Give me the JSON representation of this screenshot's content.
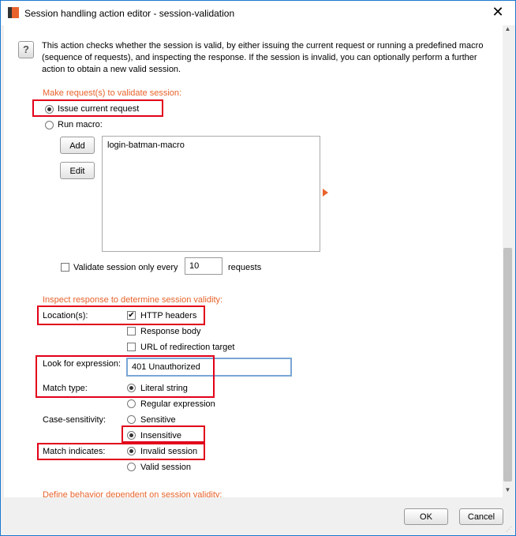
{
  "window": {
    "title": "Session handling action editor - session-validation"
  },
  "help": {
    "text": "This action checks whether the session is valid, by either issuing the current request or running a predefined macro (sequence of requests), and inspecting the response. If the session is invalid, you can optionally perform a further action to obtain a new valid session."
  },
  "request_section": {
    "heading": "Make request(s) to validate session:",
    "issue_current": "Issue current request",
    "run_macro": "Run macro:",
    "add_button": "Add",
    "edit_button": "Edit",
    "macros": [
      "login-batman-macro"
    ],
    "validate_label": "Validate session only every",
    "validate_value": "10",
    "validate_suffix": "requests"
  },
  "inspect_section": {
    "heading": "Inspect response to determine session validity:",
    "location_label": "Location(s):",
    "loc_headers": "HTTP headers",
    "loc_body": "Response body",
    "loc_redirect": "URL of redirection target",
    "expression_label": "Look for expression:",
    "expression_value": "401 Unauthorized",
    "match_type_label": "Match type:",
    "literal": "Literal string",
    "regex": "Regular expression",
    "case_label": "Case-sensitivity:",
    "sensitive": "Sensitive",
    "insensitive": "Insensitive",
    "indicates_label": "Match indicates:",
    "invalid": "Invalid session",
    "valid": "Valid session"
  },
  "behavior_section": {
    "heading": "Define behavior dependent on session validity:"
  },
  "footer": {
    "ok": "OK",
    "cancel": "Cancel"
  },
  "colors": {
    "accent": "#e8632b",
    "highlight": "#e2001a"
  },
  "icons": [
    "help-icon",
    "close-icon",
    "app-icon",
    "arrow-right-icon"
  ]
}
